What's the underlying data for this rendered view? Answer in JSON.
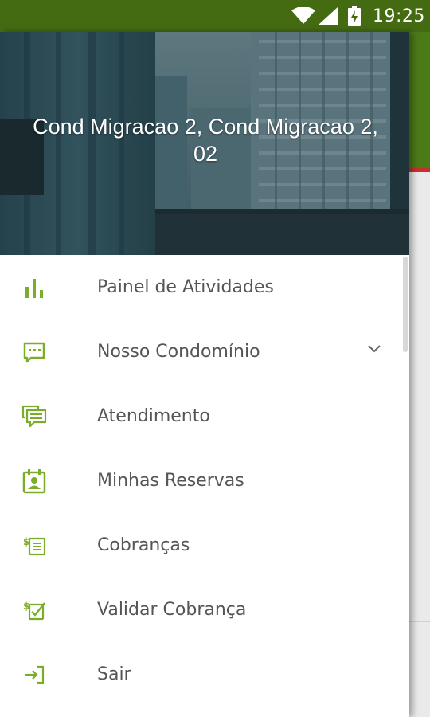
{
  "status_bar": {
    "time": "19:25",
    "icons": [
      "wifi-icon",
      "signal-icon",
      "battery-charging-icon"
    ],
    "color": "#446b12"
  },
  "drawer": {
    "header_title": "Cond Migracao 2, Cond Migracao 2, 02",
    "accent_color": "#7cad2a",
    "items": [
      {
        "label": "Painel de Atividades",
        "icon": "bar-chart-icon"
      },
      {
        "label": "Nosso Condomínio",
        "icon": "chat-bubble-icon",
        "expandable": true
      },
      {
        "label": "Atendimento",
        "icon": "chat-multiple-icon"
      },
      {
        "label": "Minhas Reservas",
        "icon": "calendar-person-icon"
      },
      {
        "label": "Cobranças",
        "icon": "dollar-list-icon"
      },
      {
        "label": "Validar Cobrança",
        "icon": "dollar-check-icon"
      },
      {
        "label": "Sair",
        "icon": "logout-icon"
      }
    ]
  }
}
